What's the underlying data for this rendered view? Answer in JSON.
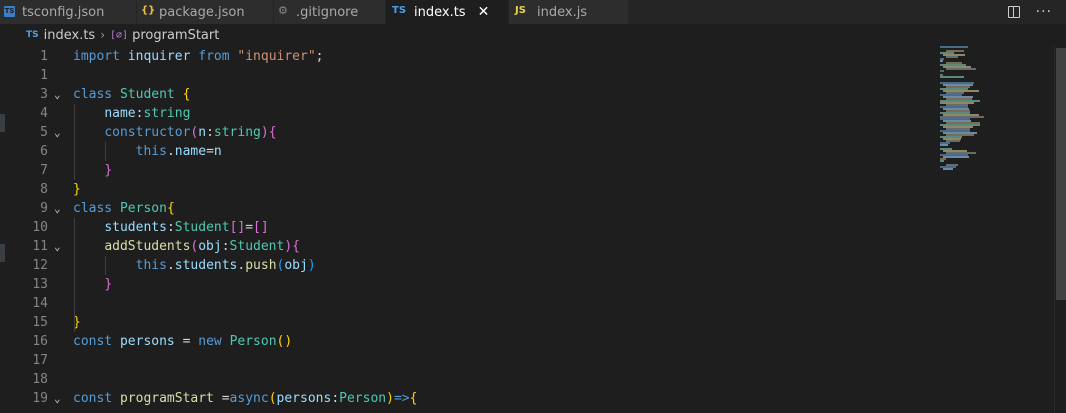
{
  "tabs": [
    {
      "label": "tsconfig.json",
      "icon": "ts-config-icon",
      "active": false
    },
    {
      "label": "package.json",
      "icon": "braces-json-icon",
      "active": false
    },
    {
      "label": ".gitignore",
      "icon": "gear-file-icon",
      "active": false
    },
    {
      "label": "index.ts",
      "icon": "typescript-file-icon",
      "active": true,
      "close": "✕"
    },
    {
      "label": "index.js",
      "icon": "javascript-file-icon",
      "active": false
    }
  ],
  "breadcrumb": {
    "file": "index.ts",
    "file_badge": "TS",
    "symbol": "programStart",
    "symbol_badge": "[∅]"
  },
  "editor": {
    "language": "typescript",
    "lines": [
      {
        "n": "1",
        "tokens": [
          [
            "import",
            "kw"
          ],
          [
            " ",
            ""
          ],
          [
            "inquirer",
            "var"
          ],
          [
            " ",
            ""
          ],
          [
            "from",
            "kw"
          ],
          [
            " ",
            ""
          ],
          [
            "\"inquirer\"",
            "str"
          ],
          [
            ";",
            "p"
          ]
        ]
      },
      {
        "n": "1",
        "tokens": []
      },
      {
        "n": "3",
        "tokens": [
          [
            "class",
            "kw"
          ],
          [
            " ",
            ""
          ],
          [
            "Student",
            "cls"
          ],
          [
            " ",
            ""
          ],
          [
            "{",
            "b1"
          ]
        ],
        "fold": true
      },
      {
        "n": "4",
        "tokens": [
          [
            "    ",
            ""
          ],
          [
            "name",
            "var"
          ],
          [
            ":",
            "p"
          ],
          [
            "string",
            "type"
          ]
        ]
      },
      {
        "n": "5",
        "tokens": [
          [
            "    ",
            ""
          ],
          [
            "constructor",
            "kw"
          ],
          [
            "(",
            "b2"
          ],
          [
            "n",
            "var"
          ],
          [
            ":",
            "p"
          ],
          [
            "string",
            "type"
          ],
          [
            ")",
            "b2"
          ],
          [
            "{",
            "b2"
          ]
        ],
        "fold": true
      },
      {
        "n": "6",
        "tokens": [
          [
            "        ",
            ""
          ],
          [
            "this",
            "kw"
          ],
          [
            ".",
            "p"
          ],
          [
            "name",
            "var"
          ],
          [
            "=",
            "p"
          ],
          [
            "n",
            "var"
          ]
        ]
      },
      {
        "n": "7",
        "tokens": [
          [
            "    ",
            ""
          ],
          [
            "}",
            "b2"
          ]
        ]
      },
      {
        "n": "8",
        "tokens": [
          [
            "}",
            "b1"
          ]
        ]
      },
      {
        "n": "9",
        "tokens": [
          [
            "class",
            "kw"
          ],
          [
            " ",
            ""
          ],
          [
            "Person",
            "cls"
          ],
          [
            "{",
            "b1"
          ]
        ],
        "fold": true
      },
      {
        "n": "10",
        "tokens": [
          [
            "    ",
            ""
          ],
          [
            "students",
            "var"
          ],
          [
            ":",
            "p"
          ],
          [
            "Student",
            "cls"
          ],
          [
            "[",
            "b2"
          ],
          [
            "]",
            "b2"
          ],
          [
            "=",
            "p"
          ],
          [
            "[",
            "b2"
          ],
          [
            "]",
            "b2"
          ]
        ]
      },
      {
        "n": "11",
        "tokens": [
          [
            "    ",
            ""
          ],
          [
            "addStudents",
            "fn"
          ],
          [
            "(",
            "b2"
          ],
          [
            "obj",
            "var"
          ],
          [
            ":",
            "p"
          ],
          [
            "Student",
            "cls"
          ],
          [
            ")",
            "b2"
          ],
          [
            "{",
            "b2"
          ]
        ],
        "fold": true
      },
      {
        "n": "12",
        "tokens": [
          [
            "        ",
            ""
          ],
          [
            "this",
            "kw"
          ],
          [
            ".",
            "p"
          ],
          [
            "students",
            "var"
          ],
          [
            ".",
            "p"
          ],
          [
            "push",
            "fn"
          ],
          [
            "(",
            "b3"
          ],
          [
            "obj",
            "var"
          ],
          [
            ")",
            "b3"
          ]
        ]
      },
      {
        "n": "13",
        "tokens": [
          [
            "    ",
            ""
          ],
          [
            "}",
            "b2"
          ]
        ]
      },
      {
        "n": "14",
        "tokens": []
      },
      {
        "n": "15",
        "tokens": [
          [
            "}",
            "b1"
          ]
        ]
      },
      {
        "n": "16",
        "tokens": [
          [
            "const",
            "kw"
          ],
          [
            " ",
            ""
          ],
          [
            "persons",
            "var"
          ],
          [
            " ",
            ""
          ],
          [
            "=",
            "p"
          ],
          [
            " ",
            ""
          ],
          [
            "new",
            "kw"
          ],
          [
            " ",
            ""
          ],
          [
            "Person",
            "cls"
          ],
          [
            "(",
            "b1"
          ],
          [
            ")",
            "b1"
          ]
        ]
      },
      {
        "n": "17",
        "tokens": []
      },
      {
        "n": "18",
        "tokens": []
      },
      {
        "n": "19",
        "tokens": [
          [
            "const",
            "kw"
          ],
          [
            " ",
            ""
          ],
          [
            "programStart",
            "fn"
          ],
          [
            " ",
            ""
          ],
          [
            "=",
            "p"
          ],
          [
            "async",
            "kw"
          ],
          [
            "(",
            "b1"
          ],
          [
            "persons",
            "var"
          ],
          [
            ":",
            "p"
          ],
          [
            "Person",
            "cls"
          ],
          [
            ")",
            "b1"
          ],
          [
            "=>",
            "kw"
          ],
          [
            "{",
            "b1"
          ]
        ],
        "fold": true
      }
    ]
  },
  "colors": {
    "kw": "#569cd6",
    "var": "#9cdcfe",
    "str": "#ce9178",
    "cls": "#4ec9b0",
    "type": "#4ec9b0",
    "fn": "#dcdcaa",
    "p": "#d4d4d4",
    "b1": "#ffd700",
    "b2": "#da70d6",
    "b3": "#179fff"
  }
}
